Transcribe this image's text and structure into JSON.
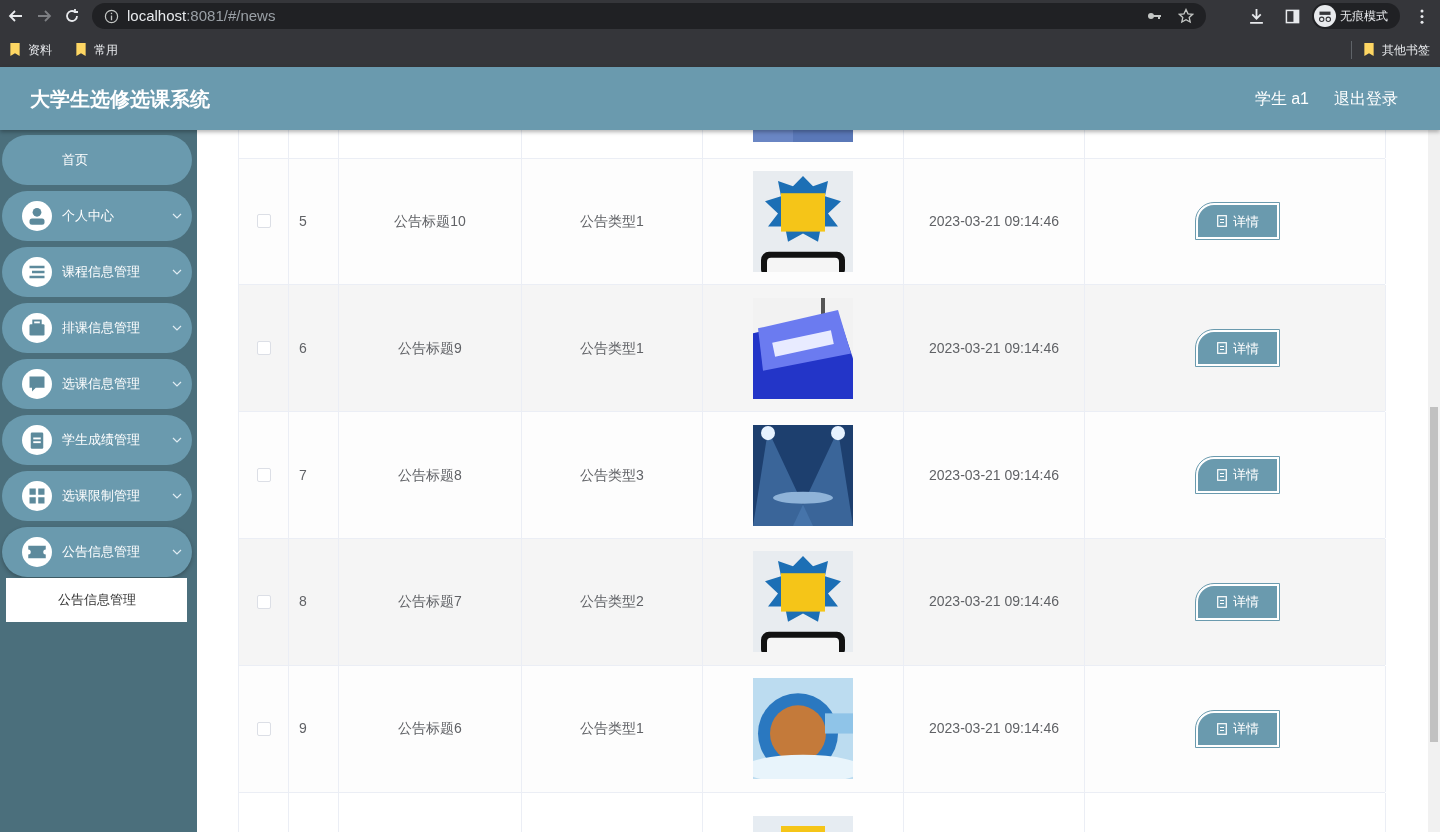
{
  "browser": {
    "url_host": "localhost",
    "url_rest": ":8081/#/news",
    "profile": "无痕模式",
    "bookmarks": [
      "资料",
      "常用"
    ],
    "other_bookmarks": "其他书签"
  },
  "header": {
    "title": "大学生选修选课系统",
    "user": "学生 a1",
    "logout": "退出登录"
  },
  "sidebar": {
    "items": [
      {
        "label": "首页",
        "expanded": false
      },
      {
        "label": "个人中心",
        "expanded": false
      },
      {
        "label": "课程信息管理",
        "expanded": false
      },
      {
        "label": "排课信息管理",
        "expanded": false
      },
      {
        "label": "选课信息管理",
        "expanded": false
      },
      {
        "label": "学生成绩管理",
        "expanded": false
      },
      {
        "label": "选课限制管理",
        "expanded": false
      },
      {
        "label": "公告信息管理",
        "expanded": true,
        "children": [
          {
            "label": "公告信息管理",
            "selected": true
          }
        ]
      }
    ]
  },
  "table": {
    "rows": [
      {
        "checked": false,
        "index": "5",
        "title": "公告标题10",
        "type": "公告类型1",
        "time": "2023-03-21 09:14:46",
        "action": "详情"
      },
      {
        "checked": false,
        "index": "6",
        "title": "公告标题9",
        "type": "公告类型1",
        "time": "2023-03-21 09:14:46",
        "action": "详情"
      },
      {
        "checked": false,
        "index": "7",
        "title": "公告标题8",
        "type": "公告类型3",
        "time": "2023-03-21 09:14:46",
        "action": "详情"
      },
      {
        "checked": false,
        "index": "8",
        "title": "公告标题7",
        "type": "公告类型2",
        "time": "2023-03-21 09:14:46",
        "action": "详情"
      },
      {
        "checked": false,
        "index": "9",
        "title": "公告标题6",
        "type": "公告类型1",
        "time": "2023-03-21 09:14:46",
        "action": "详情"
      }
    ]
  }
}
